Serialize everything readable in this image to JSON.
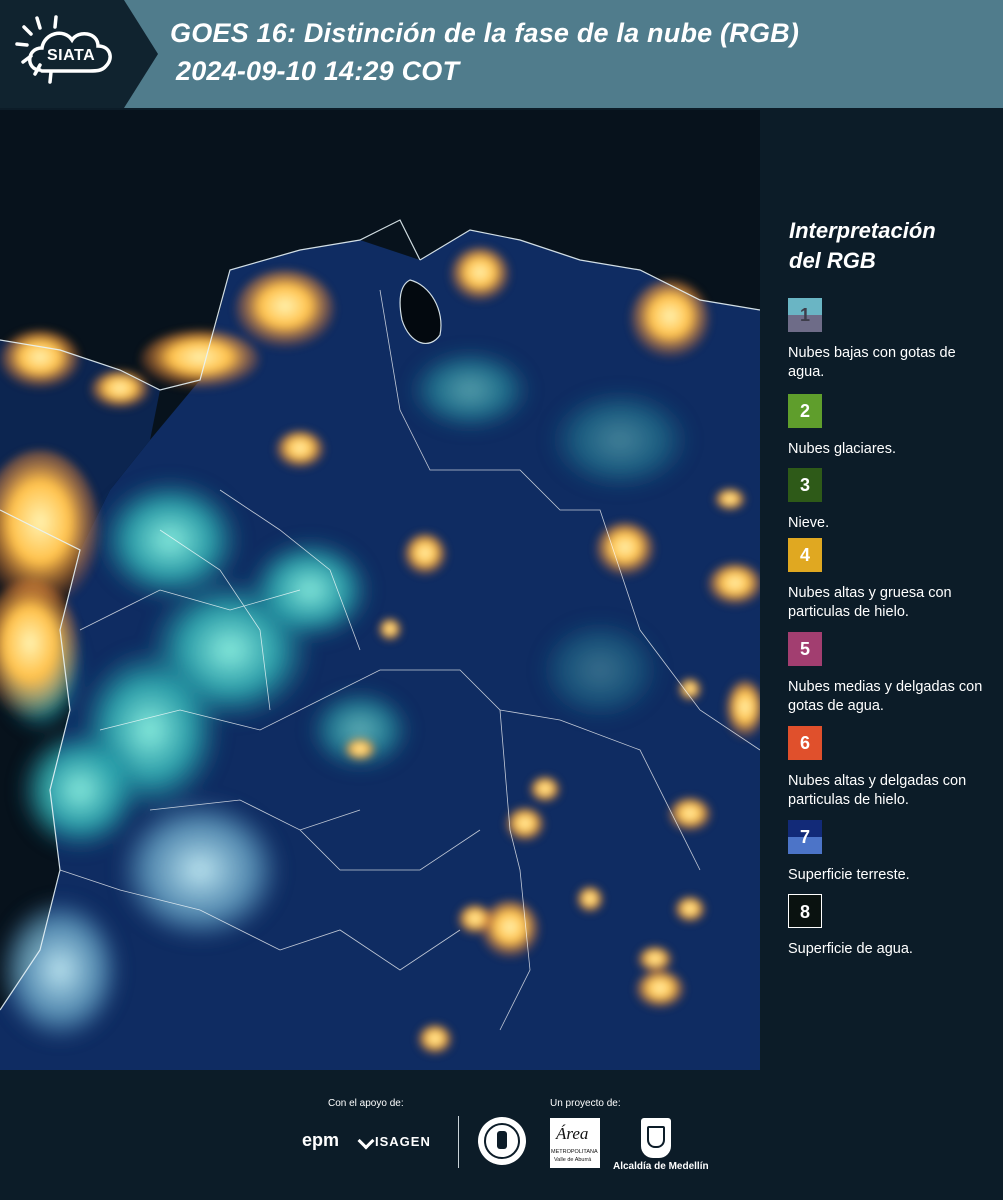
{
  "header": {
    "logo_text": "SIATA",
    "title_line1": "GOES 16: Distinción de la fase de la nube (RGB)",
    "title_line2": "2024-09-10 14:29 COT"
  },
  "legend": {
    "title_line1": "Interpretación",
    "title_line2": "del RGB",
    "items": [
      {
        "num": "1",
        "label": "Nubes bajas con gotas de agua.",
        "top_color": "#6ab5c4",
        "bottom_color": "#6e6c88"
      },
      {
        "num": "2",
        "label": "Nubes glaciares.",
        "color": "#5f9e2c"
      },
      {
        "num": "3",
        "label": "Nieve.",
        "color": "#2e5a18"
      },
      {
        "num": "4",
        "label": "Nubes altas y gruesa con particulas de hielo.",
        "color": "#e0a821"
      },
      {
        "num": "5",
        "label": "Nubes medias y delgadas con gotas de agua.",
        "color": "#a23e70"
      },
      {
        "num": "6",
        "label": "Nubes altas y delgadas con particulas de hielo.",
        "color": "#e0502c"
      },
      {
        "num": "7",
        "label": "Superficie terreste.",
        "top_color": "#122a78",
        "bottom_color": "#4c74c8"
      },
      {
        "num": "8",
        "label": "Superficie de agua.",
        "color": "#0a1210"
      }
    ]
  },
  "footer": {
    "support_label": "Con el apoyo de:",
    "support_logo1": "epm",
    "support_logo2": "ISAGEN",
    "project_label": "Un proyecto de:",
    "area_logo_text": "Área",
    "area_logo_sub": "METROPOLITANA",
    "area_logo_sub2": "Valle de Aburrá",
    "alcaldia_label": "Alcaldía de Medellín"
  },
  "colors": {
    "header_bg": "#507c8c",
    "page_bg": "#0c1c28",
    "ocean": "#081420",
    "land": "#10306a",
    "cloud_low": "#4bc8d0",
    "cloud_high": "#ffb54a"
  }
}
